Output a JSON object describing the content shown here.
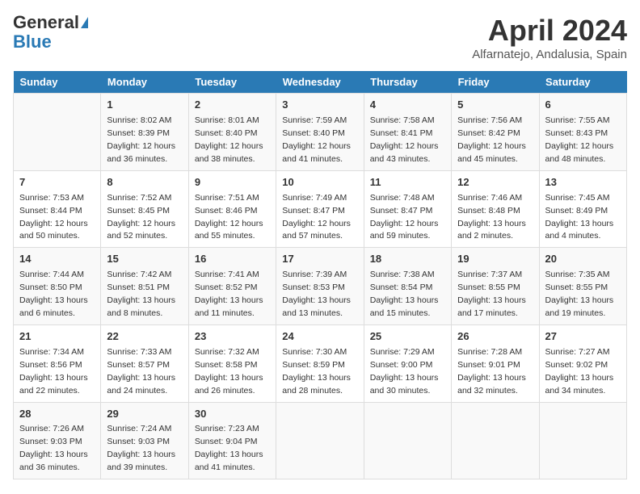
{
  "header": {
    "logo_general": "General",
    "logo_blue": "Blue",
    "month_title": "April 2024",
    "location": "Alfarnatejo, Andalusia, Spain"
  },
  "days_of_week": [
    "Sunday",
    "Monday",
    "Tuesday",
    "Wednesday",
    "Thursday",
    "Friday",
    "Saturday"
  ],
  "weeks": [
    [
      {
        "day": "",
        "sunrise": "",
        "sunset": "",
        "daylight": ""
      },
      {
        "day": "1",
        "sunrise": "Sunrise: 8:02 AM",
        "sunset": "Sunset: 8:39 PM",
        "daylight": "Daylight: 12 hours and 36 minutes."
      },
      {
        "day": "2",
        "sunrise": "Sunrise: 8:01 AM",
        "sunset": "Sunset: 8:40 PM",
        "daylight": "Daylight: 12 hours and 38 minutes."
      },
      {
        "day": "3",
        "sunrise": "Sunrise: 7:59 AM",
        "sunset": "Sunset: 8:40 PM",
        "daylight": "Daylight: 12 hours and 41 minutes."
      },
      {
        "day": "4",
        "sunrise": "Sunrise: 7:58 AM",
        "sunset": "Sunset: 8:41 PM",
        "daylight": "Daylight: 12 hours and 43 minutes."
      },
      {
        "day": "5",
        "sunrise": "Sunrise: 7:56 AM",
        "sunset": "Sunset: 8:42 PM",
        "daylight": "Daylight: 12 hours and 45 minutes."
      },
      {
        "day": "6",
        "sunrise": "Sunrise: 7:55 AM",
        "sunset": "Sunset: 8:43 PM",
        "daylight": "Daylight: 12 hours and 48 minutes."
      }
    ],
    [
      {
        "day": "7",
        "sunrise": "Sunrise: 7:53 AM",
        "sunset": "Sunset: 8:44 PM",
        "daylight": "Daylight: 12 hours and 50 minutes."
      },
      {
        "day": "8",
        "sunrise": "Sunrise: 7:52 AM",
        "sunset": "Sunset: 8:45 PM",
        "daylight": "Daylight: 12 hours and 52 minutes."
      },
      {
        "day": "9",
        "sunrise": "Sunrise: 7:51 AM",
        "sunset": "Sunset: 8:46 PM",
        "daylight": "Daylight: 12 hours and 55 minutes."
      },
      {
        "day": "10",
        "sunrise": "Sunrise: 7:49 AM",
        "sunset": "Sunset: 8:47 PM",
        "daylight": "Daylight: 12 hours and 57 minutes."
      },
      {
        "day": "11",
        "sunrise": "Sunrise: 7:48 AM",
        "sunset": "Sunset: 8:47 PM",
        "daylight": "Daylight: 12 hours and 59 minutes."
      },
      {
        "day": "12",
        "sunrise": "Sunrise: 7:46 AM",
        "sunset": "Sunset: 8:48 PM",
        "daylight": "Daylight: 13 hours and 2 minutes."
      },
      {
        "day": "13",
        "sunrise": "Sunrise: 7:45 AM",
        "sunset": "Sunset: 8:49 PM",
        "daylight": "Daylight: 13 hours and 4 minutes."
      }
    ],
    [
      {
        "day": "14",
        "sunrise": "Sunrise: 7:44 AM",
        "sunset": "Sunset: 8:50 PM",
        "daylight": "Daylight: 13 hours and 6 minutes."
      },
      {
        "day": "15",
        "sunrise": "Sunrise: 7:42 AM",
        "sunset": "Sunset: 8:51 PM",
        "daylight": "Daylight: 13 hours and 8 minutes."
      },
      {
        "day": "16",
        "sunrise": "Sunrise: 7:41 AM",
        "sunset": "Sunset: 8:52 PM",
        "daylight": "Daylight: 13 hours and 11 minutes."
      },
      {
        "day": "17",
        "sunrise": "Sunrise: 7:39 AM",
        "sunset": "Sunset: 8:53 PM",
        "daylight": "Daylight: 13 hours and 13 minutes."
      },
      {
        "day": "18",
        "sunrise": "Sunrise: 7:38 AM",
        "sunset": "Sunset: 8:54 PM",
        "daylight": "Daylight: 13 hours and 15 minutes."
      },
      {
        "day": "19",
        "sunrise": "Sunrise: 7:37 AM",
        "sunset": "Sunset: 8:55 PM",
        "daylight": "Daylight: 13 hours and 17 minutes."
      },
      {
        "day": "20",
        "sunrise": "Sunrise: 7:35 AM",
        "sunset": "Sunset: 8:55 PM",
        "daylight": "Daylight: 13 hours and 19 minutes."
      }
    ],
    [
      {
        "day": "21",
        "sunrise": "Sunrise: 7:34 AM",
        "sunset": "Sunset: 8:56 PM",
        "daylight": "Daylight: 13 hours and 22 minutes."
      },
      {
        "day": "22",
        "sunrise": "Sunrise: 7:33 AM",
        "sunset": "Sunset: 8:57 PM",
        "daylight": "Daylight: 13 hours and 24 minutes."
      },
      {
        "day": "23",
        "sunrise": "Sunrise: 7:32 AM",
        "sunset": "Sunset: 8:58 PM",
        "daylight": "Daylight: 13 hours and 26 minutes."
      },
      {
        "day": "24",
        "sunrise": "Sunrise: 7:30 AM",
        "sunset": "Sunset: 8:59 PM",
        "daylight": "Daylight: 13 hours and 28 minutes."
      },
      {
        "day": "25",
        "sunrise": "Sunrise: 7:29 AM",
        "sunset": "Sunset: 9:00 PM",
        "daylight": "Daylight: 13 hours and 30 minutes."
      },
      {
        "day": "26",
        "sunrise": "Sunrise: 7:28 AM",
        "sunset": "Sunset: 9:01 PM",
        "daylight": "Daylight: 13 hours and 32 minutes."
      },
      {
        "day": "27",
        "sunrise": "Sunrise: 7:27 AM",
        "sunset": "Sunset: 9:02 PM",
        "daylight": "Daylight: 13 hours and 34 minutes."
      }
    ],
    [
      {
        "day": "28",
        "sunrise": "Sunrise: 7:26 AM",
        "sunset": "Sunset: 9:03 PM",
        "daylight": "Daylight: 13 hours and 36 minutes."
      },
      {
        "day": "29",
        "sunrise": "Sunrise: 7:24 AM",
        "sunset": "Sunset: 9:03 PM",
        "daylight": "Daylight: 13 hours and 39 minutes."
      },
      {
        "day": "30",
        "sunrise": "Sunrise: 7:23 AM",
        "sunset": "Sunset: 9:04 PM",
        "daylight": "Daylight: 13 hours and 41 minutes."
      },
      {
        "day": "",
        "sunrise": "",
        "sunset": "",
        "daylight": ""
      },
      {
        "day": "",
        "sunrise": "",
        "sunset": "",
        "daylight": ""
      },
      {
        "day": "",
        "sunrise": "",
        "sunset": "",
        "daylight": ""
      },
      {
        "day": "",
        "sunrise": "",
        "sunset": "",
        "daylight": ""
      }
    ]
  ]
}
